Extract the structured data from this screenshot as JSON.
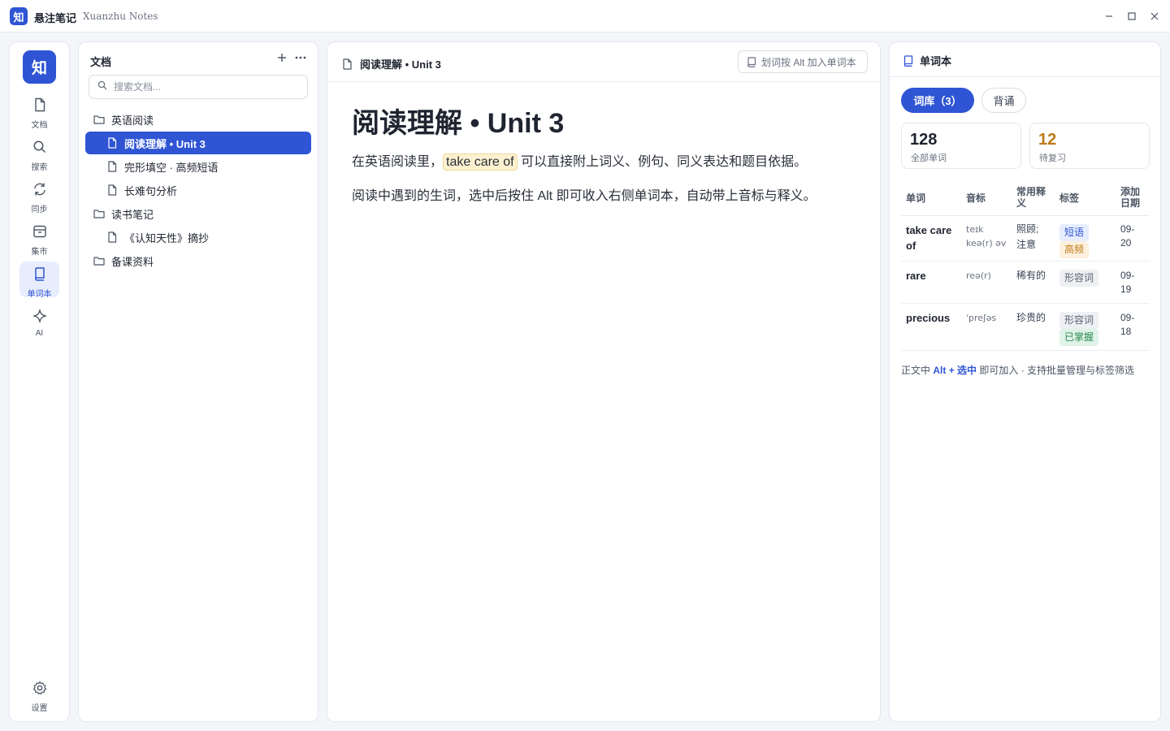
{
  "app": {
    "title": "悬注笔记",
    "subtitle": "Xuanzhu Notes",
    "logo_char": "知",
    "accent": "#2f55d4"
  },
  "rail": {
    "items": [
      {
        "label": "文档",
        "icon": "document-icon"
      },
      {
        "label": "搜索",
        "icon": "search-icon"
      },
      {
        "label": "同步",
        "icon": "sync-icon"
      },
      {
        "label": "集市",
        "icon": "archive-icon"
      },
      {
        "label": "单词本",
        "icon": "book-icon",
        "active": true
      },
      {
        "label": "AI",
        "icon": "sparkle-icon"
      }
    ],
    "settings_label": "设置"
  },
  "tree": {
    "title": "文档",
    "search_placeholder": "搜索文档...",
    "nodes": [
      {
        "type": "folder",
        "label": "英语阅读"
      },
      {
        "type": "doc",
        "label": "阅读理解 • Unit 3",
        "selected": true
      },
      {
        "type": "doc",
        "label": "完形填空 · 高频短语"
      },
      {
        "type": "doc",
        "label": "长难句分析"
      },
      {
        "type": "folder",
        "label": "读书笔记"
      },
      {
        "type": "doc",
        "label": "《认知天性》摘抄"
      },
      {
        "type": "folder",
        "label": "备课资料"
      }
    ]
  },
  "editor": {
    "tab_title": "阅读理解 • Unit 3",
    "hint_button": "划词按 Alt 加入单词本",
    "doc_title": "阅读理解 • Unit 3",
    "para1_before": "在英语阅读里，",
    "para1_highlight": "take care of",
    "para1_after": "可以直接附上词义、例句、同义表达和题目依据。",
    "para2": "阅读中遇到的生词，选中后按住 Alt 即可收入右侧单词本，自动带上音标与释义。"
  },
  "vocab": {
    "title": "单词本",
    "tabs": [
      "词库（3）",
      "背诵"
    ],
    "stats": [
      {
        "value": "128",
        "caption": "全部单词"
      },
      {
        "value": "12",
        "caption": "待复习"
      }
    ],
    "columns": [
      "单词",
      "音标",
      "常用释义",
      "标签",
      "添加日期"
    ],
    "rows": [
      {
        "word": "take care of",
        "phonetic": [
          "teɪk",
          "keə(r) əv"
        ],
        "meaning": [
          "照顾;",
          "注意"
        ],
        "tags": [
          {
            "label": "短语",
            "color": "blue"
          },
          {
            "label": "高频",
            "color": "orange"
          }
        ],
        "date": [
          "09-",
          "20"
        ]
      },
      {
        "word": "rare",
        "phonetic": [
          "reə(r)"
        ],
        "meaning": [
          "稀有的"
        ],
        "tags": [
          {
            "label": "形容词",
            "color": "gray"
          }
        ],
        "date": [
          "09-",
          "19"
        ]
      },
      {
        "word": "precious",
        "phonetic": [
          "ˈpreʃəs"
        ],
        "meaning": [
          "珍贵的"
        ],
        "tags": [
          {
            "label": "形容词",
            "color": "gray"
          },
          {
            "label": "已掌握",
            "color": "green"
          }
        ],
        "date": [
          "09-",
          "18"
        ]
      }
    ],
    "footer_prefix": "正文中",
    "footer_key": "Alt + 选中",
    "footer_suffix": "即可加入 · 支持批量管理与标签筛选"
  }
}
